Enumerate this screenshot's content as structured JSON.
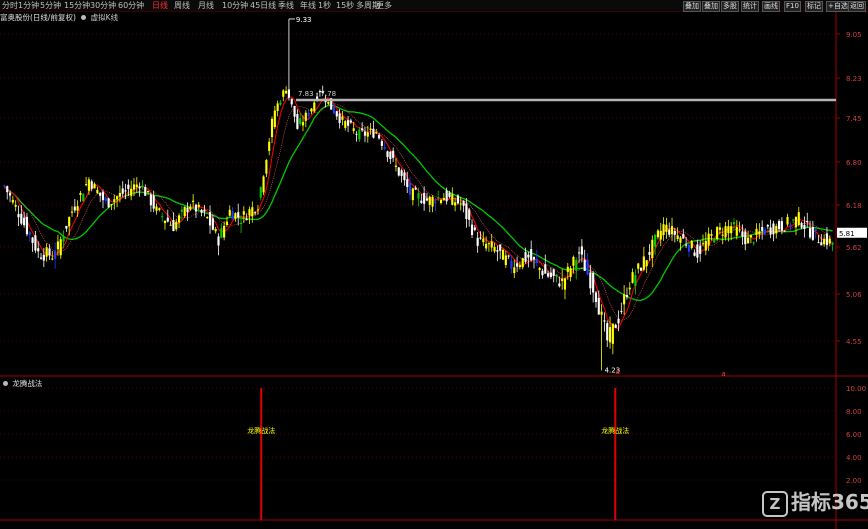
{
  "toolbar": {
    "timeframes": [
      "分时",
      "1分钟",
      "5分钟",
      "15分钟",
      "30分钟",
      "60分钟",
      "日线",
      "周线",
      "月线",
      "10分钟",
      "45日线",
      "季线",
      "年线",
      "1秒",
      "15秒",
      "多周期",
      "更多"
    ],
    "active_timeframe": "日线",
    "right_buttons": [
      "叠加",
      "叠加",
      "多股",
      "统计",
      "画线",
      "F10",
      "标记",
      "+自选",
      "返回"
    ]
  },
  "info": {
    "stock_label": "富奥股份(日线/前复权)",
    "indicator_label": "虚拟K线"
  },
  "sub_panel": {
    "title": "龙腾战法",
    "signal_label": "龙腾战法"
  },
  "watermark": {
    "icon_letter": "Z",
    "text": "指标365"
  },
  "colors": {
    "bull_yellow": "#ffff00",
    "bull_green": "#00cc00",
    "bear_white": "#ffffff",
    "bear_blue": "#1e3cff",
    "ma_red": "#ee0000",
    "ma_green": "#00c800",
    "grid_red": "#4a0000",
    "axis_red": "#a00000",
    "level_line": "#b4b4b4"
  },
  "chart_data": {
    "type": "candlestick",
    "y_axis_ticks": [
      "9.05",
      "8.23",
      "7.45",
      "6.80",
      "6.18",
      "5.62",
      "5.06",
      "4.55"
    ],
    "sub_axis_ticks": [
      "10.00",
      "8.00",
      "6.00",
      "4.00",
      "2.00"
    ],
    "high_label": "9.33",
    "low_label": "4.23",
    "level_line_label": "7.83 - 7.78",
    "current_price_label": "5.81",
    "signal_positions": [
      0.31,
      0.735
    ],
    "series": [
      {
        "name": "K线",
        "values": "ohlc"
      },
      {
        "name": "均线一",
        "color": "#ee0000"
      },
      {
        "name": "均线二",
        "color": "#00c800"
      }
    ]
  }
}
